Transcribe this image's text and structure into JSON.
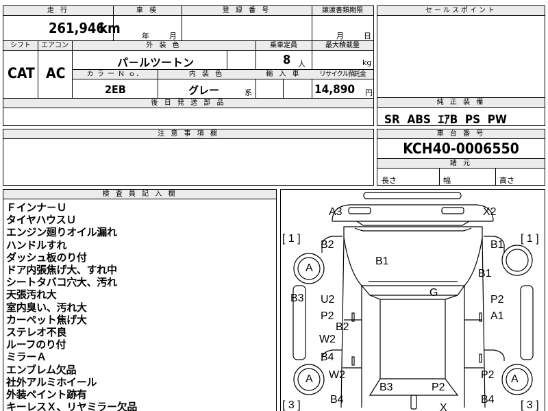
{
  "top_fields": {
    "mileage_label": "走 行",
    "mileage_value": "261,946",
    "mileage_unit": "km",
    "inspection_label": "車 検",
    "inspection_year": "年",
    "inspection_month": "月",
    "registration_label": "登 録 番 号",
    "transfer_label": "譲渡書類期限",
    "transfer_month": "月",
    "transfer_day": "日"
  },
  "spec": {
    "shift_label": "シフト",
    "shift_value": "CAT",
    "ac_label": "エアコン",
    "ac_value": "AC",
    "exterior_color_label": "外 装 色",
    "exterior_color_value": "パ－ルツートン",
    "capacity_label": "乗車定員",
    "capacity_value": "8",
    "capacity_unit": "人",
    "max_load_label": "最大積載量",
    "max_load_unit": "kg",
    "color_no_label": "カ ラ ー Ｎ ｏ．",
    "color_no_value": "2EB",
    "interior_color_label": "内 装 色",
    "interior_color_value": "グレー",
    "interior_color_suffix": "系",
    "import_label": "輸 入 車",
    "recycle_label": "リサイクル預託金",
    "recycle_value": "14,890",
    "recycle_unit": "円",
    "later_parts_label": "後 日 発 送 部 品"
  },
  "sales_point": {
    "label": "セールスポイント"
  },
  "equipment": {
    "label": "純 正 装 備",
    "value": "SR  ABS  ｴｱB  PS  PW"
  },
  "caution": {
    "label": "注 意 事 項 欄"
  },
  "chassis": {
    "label": "車 台 番 号",
    "value": "KCH40-0006550",
    "dims_label": "諸 元",
    "length_label": "長さ",
    "width_label": "幅",
    "height_label": "高さ"
  },
  "inspector": {
    "label": "検 査 員 記 入 欄",
    "notes": [
      "Ｆインナ－Ｕ",
      "タイヤハウスＵ",
      "エンジン廻りオイル漏れ",
      "ハンドルすれ",
      "ダッシュ板のり付",
      "ドア内張焦げ大、すれ中",
      "シートタバコ穴大、汚れ",
      "天張汚れ大",
      "室内臭い、汚れ大",
      "カーペット焦げ大",
      "ステレオ不良",
      "ルーフのり付",
      "ミラーＡ",
      "エンブレム欠品",
      "社外アルミホイール",
      "外装ペイント跡有",
      "キーレスＸ、リヤミラー欠品"
    ]
  },
  "diagram": {
    "labels": {
      "a3": "A3",
      "x2": "X2",
      "bracket_left_1": "[ 1 ]",
      "bracket_right_1": "[ 1 ]",
      "bracket_left_3": "[ 3 ]",
      "bracket_right_3": "[ 3 ]",
      "b2_left": "B2",
      "b1_hood": "B1",
      "b1_right_top": "B1",
      "b1_right": "B1",
      "a_front_left": "A",
      "a_front_right": "A",
      "a_rear_left": "A",
      "a_rear_right": "A",
      "b3_left": "B3",
      "u2": "U2",
      "g": "G",
      "p2_right_top": "P2",
      "p2_left": "P2",
      "a1": "A1",
      "b2_center": "B2",
      "w2_left": "W2",
      "b4_left": "B4",
      "w2_left_low": "W2",
      "p2_right_low": "P2",
      "b3_rear": "B3",
      "p2_rear": "P2",
      "b4_rear_left": "B4",
      "b4_rear_right": "B4",
      "x_rear": "X"
    }
  }
}
